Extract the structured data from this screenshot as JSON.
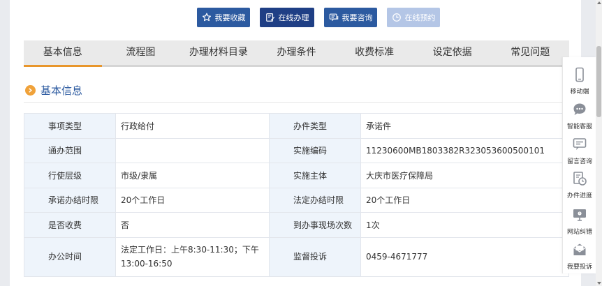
{
  "actions": {
    "favorite": "我要收藏",
    "online_handle": "在线办理",
    "consult": "我要咨询",
    "reserve": "在线预约"
  },
  "tabs": [
    {
      "label": "基本信息",
      "active": true
    },
    {
      "label": "流程图",
      "active": false
    },
    {
      "label": "办理材料目录",
      "active": false
    },
    {
      "label": "办理条件",
      "active": false
    },
    {
      "label": "收费标准",
      "active": false
    },
    {
      "label": "设定依据",
      "active": false
    },
    {
      "label": "常见问题",
      "active": false
    }
  ],
  "section": {
    "title": "基本信息"
  },
  "info": {
    "rows": [
      {
        "l1": "事项类型",
        "v1": "行政给付",
        "l2": "办件类型",
        "v2": "承诺件"
      },
      {
        "l1": "通办范围",
        "v1": "",
        "l2": "实施编码",
        "v2": "11230600MB1803382R323053600500101"
      },
      {
        "l1": "行使层级",
        "v1": "市级/隶属",
        "l2": "实施主体",
        "v2": "大庆市医疗保障局"
      },
      {
        "l1": "承诺办结时限",
        "v1": "20个工作日",
        "l2": "法定办结时限",
        "v2": "20个工作日"
      },
      {
        "l1": "是否收费",
        "v1": "否",
        "l2": "到办事现场次数",
        "v2": "1次"
      },
      {
        "l1": "办公时间",
        "v1": "法定工作日：上午8:30-11:30；下午13:00-16:50",
        "l2": "监督投诉",
        "v2": "0459-4671777"
      }
    ]
  },
  "float_panel": [
    {
      "label": "移动端",
      "icon": "mobile-icon"
    },
    {
      "label": "智能客服",
      "icon": "chat-bot-icon"
    },
    {
      "label": "留言咨询",
      "icon": "message-icon"
    },
    {
      "label": "办件进度",
      "icon": "progress-icon"
    },
    {
      "label": "网站纠错",
      "icon": "monitor-icon"
    },
    {
      "label": "我要投诉",
      "icon": "mail-icon"
    }
  ],
  "colors": {
    "primary": "#2c5aa0",
    "primary_dark": "#1f3f85",
    "disabled": "#b4c6e6",
    "accent": "#e8962c",
    "label_bg": "#eef4fb"
  }
}
